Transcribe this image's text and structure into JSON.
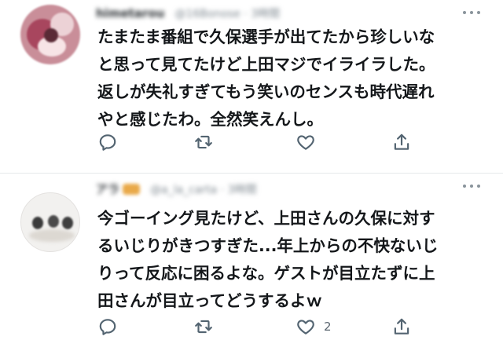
{
  "tweets": [
    {
      "display_name": "himetarou",
      "handle_time": "@16Bonose · 3時間",
      "text_lines": [
        "たまたま番組で久保選手が出てたから珍しいな",
        "と思って見てたけど上田マジでイライラした。",
        "返しが失礼すぎてもう笑いのセンスも時代遅れ",
        "やと感じたわ。全然笑えんし。"
      ],
      "actions": {
        "reply_icon": "reply-icon",
        "retweet_icon": "retweet-icon",
        "like_icon": "heart-icon",
        "like_count": "",
        "share_icon": "share-icon"
      }
    },
    {
      "display_name": "アラ",
      "handle_time": "@a_la_carta · 3時間",
      "text_lines": [
        "今ゴーイング見たけど、上田さんの久保に対す",
        "るいじりがきつすぎた...年上からの不快ないじ",
        "りって反応に困るよな。ゲストが目立たずに上",
        "田さんが目立ってどうするよｗ"
      ],
      "actions": {
        "reply_icon": "reply-icon",
        "retweet_icon": "retweet-icon",
        "like_icon": "heart-icon",
        "like_count": "2",
        "share_icon": "share-icon"
      }
    }
  ],
  "colors": {
    "text": "#14171a",
    "icon": "#536471",
    "divider": "#e6e8ea",
    "background": "#ffffff"
  }
}
